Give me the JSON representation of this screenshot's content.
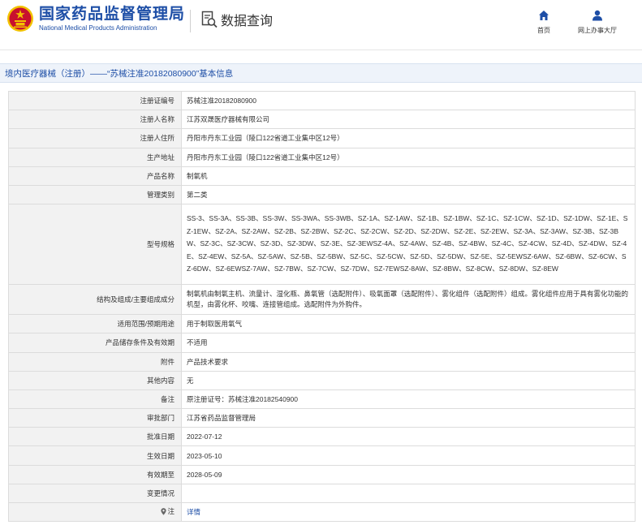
{
  "header": {
    "logo_cn": "国家药品监督管理局",
    "logo_en": "National Medical Products Administration",
    "query_label": "数据查询",
    "nav": [
      {
        "label": "首页",
        "icon": "home-icon"
      },
      {
        "label": "网上办事大厅",
        "icon": "user-icon"
      }
    ]
  },
  "page": {
    "title": "境内医疗器械（注册）——“苏械注准20182080900”基本信息"
  },
  "colors": {
    "brand_blue": "#1d4ea6",
    "emblem_red": "#c8102e",
    "emblem_gold": "#f2c200"
  },
  "rows": [
    {
      "label": "注册证编号",
      "value": "苏械注准20182080900"
    },
    {
      "label": "注册人名称",
      "value": "江苏双晟医疗器械有限公司"
    },
    {
      "label": "注册人住所",
      "value": "丹阳市丹东工业园（陵口122省道工业集中区12号）"
    },
    {
      "label": "生产地址",
      "value": "丹阳市丹东工业园（陵口122省道工业集中区12号）"
    },
    {
      "label": "产品名称",
      "value": "制氧机"
    },
    {
      "label": "管理类别",
      "value": "第二类"
    },
    {
      "label": "型号规格",
      "value": "SS-3、SS-3A、SS-3B、SS-3W、SS-3WA、SS-3WB、SZ-1A、SZ-1AW、SZ-1B、SZ-1BW、SZ-1C、SZ-1CW、SZ-1D、SZ-1DW、SZ-1E、SZ-1EW、SZ-2A、SZ-2AW、SZ-2B、SZ-2BW、SZ-2C、SZ-2CW、SZ-2D、SZ-2DW、SZ-2E、SZ-2EW、SZ-3A、SZ-3AW、SZ-3B、SZ-3BW、SZ-3C、SZ-3CW、SZ-3D、SZ-3DW、SZ-3E、SZ-3EWSZ-4A、SZ-4AW、SZ-4B、SZ-4BW、SZ-4C、SZ-4CW、SZ-4D、SZ-4DW、SZ-4E、SZ-4EW、SZ-5A、SZ-5AW、SZ-5B、SZ-5BW、SZ-5C、SZ-5CW、SZ-5D、SZ-5DW、SZ-5E、SZ-5EWSZ-6AW、SZ-6BW、SZ-6CW、SZ-6DW、SZ-6EWSZ-7AW、SZ-7BW、SZ-7CW、SZ-7DW、SZ-7EWSZ-8AW、SZ-8BW、SZ-8CW、SZ-8DW、SZ-8EW"
    },
    {
      "label": "结构及组成/主要组成成分",
      "value": "制氧机由制氧主机、流量计、湿化瓶、鼻氧管（选配附件）、吸氧面罩（选配附件）、雾化组件（选配附件）组成。雾化组件应用于具有雾化功能的机型，由雾化杯、咬嘴、连接管组成。选配附件为外购件。"
    },
    {
      "label": "适用范围/预期用途",
      "value": "用于制取医用氧气"
    },
    {
      "label": "产品储存条件及有效期",
      "value": "不适用"
    },
    {
      "label": "附件",
      "value": "产品技术要求"
    },
    {
      "label": "其他内容",
      "value": "无"
    },
    {
      "label": "备注",
      "value": "原注册证号：苏械注准20182540900"
    },
    {
      "label": "审批部门",
      "value": "江苏省药品监督管理局"
    },
    {
      "label": "批准日期",
      "value": "2022-07-12"
    },
    {
      "label": "生效日期",
      "value": "2023-05-10"
    },
    {
      "label": "有效期至",
      "value": "2028-05-09"
    },
    {
      "label": "变更情况",
      "value": ""
    },
    {
      "label": "注",
      "value": "详情"
    }
  ]
}
